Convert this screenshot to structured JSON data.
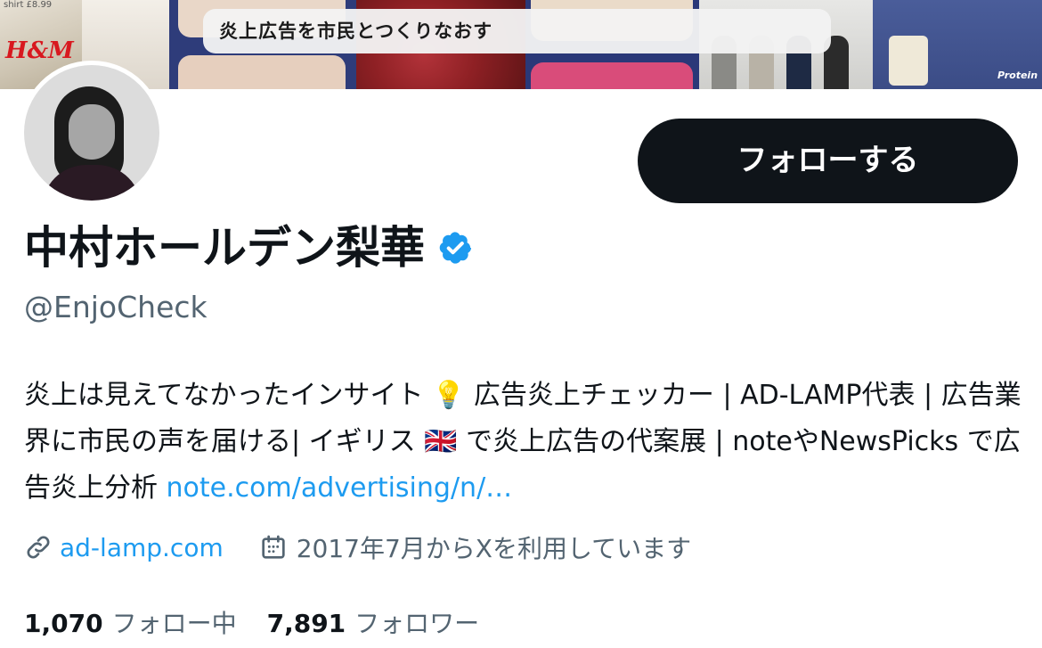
{
  "banner": {
    "caption": "炎上広告を市民とつくりなおす",
    "brand_logo": "H&M",
    "shirt_price": "shirt £8.99",
    "protein_label": "Protein"
  },
  "profile": {
    "display_name": "中村ホールデン梨華",
    "handle": "@EnjoCheck",
    "verified": true,
    "follow_button_label": "フォローする",
    "bio_text": "炎上は見えてなかったインサイト 💡 広告炎上チェッカー | AD-LAMP代表 | 広告業界に市民の声を届ける| イギリス 🇬🇧 で炎上広告の代案展 | noteやNewsPicks で広告炎上分析 ",
    "bio_link": "note.com/advertising/n/…",
    "website": "ad-lamp.com",
    "joined": "2017年7月からXを利用しています"
  },
  "stats": {
    "following_count": "1,070",
    "following_label": "フォロー中",
    "followers_count": "7,891",
    "followers_label": "フォロワー"
  },
  "colors": {
    "primary_text": "#0f1419",
    "secondary_text": "#536471",
    "link": "#1d9bf0",
    "button_bg": "#0f1419",
    "verified": "#1d9bf0"
  },
  "icons": {
    "verified": "verified-badge-icon",
    "website": "link-icon",
    "joined": "calendar-icon"
  }
}
